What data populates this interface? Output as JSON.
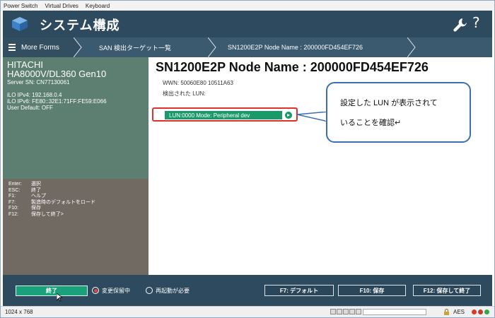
{
  "menubar": {
    "items": [
      "Power Switch",
      "Virtual Drives",
      "Keyboard"
    ]
  },
  "app": {
    "title": "システム構成"
  },
  "nav": {
    "more_forms": "More Forms",
    "crumbs": [
      "SAN 検出ターゲット一覧",
      "SN1200E2P Node Name : 200000FD454EF726"
    ]
  },
  "server": {
    "vendor": "HITACHI",
    "model": "HA8000V/DL360 Gen10",
    "serial": "Server SN: CN77130061",
    "ipv4": "iLO IPv4: 192.168.0.4",
    "ipv6": "iLO IPv6: FE80::32E1:71FF:FE59:E066",
    "user_default": "User Default: OFF"
  },
  "help_keys": [
    {
      "key": "Enter:",
      "desc": "選択"
    },
    {
      "key": "ESC:",
      "desc": "終了"
    },
    {
      "key": "F1:",
      "desc": "ヘルプ"
    },
    {
      "key": "F7:",
      "desc": "製造時のデフォルトをロード"
    },
    {
      "key": "F10:",
      "desc": "保存"
    },
    {
      "key": "F12:",
      "desc": "保存して終了>"
    }
  ],
  "main": {
    "title": "SN1200E2P Node Name : 200000FD454EF726",
    "wwn": "WWN: 50060E80 10511A63",
    "detected_lun": "検出された LUN:",
    "lun_entry": "LUN:0000 Mode: Peripheral dev"
  },
  "callout": {
    "line1": "設定した LUN が表示されて",
    "line2": "いることを確認↵"
  },
  "bottom": {
    "exit": "終了",
    "radio_changes_pending": "変更保留中",
    "radio_reboot_required": "再起動が必要",
    "f7": "F7: デフォルト",
    "f10": "F10: 保存",
    "f12": "F12: 保存して終了"
  },
  "status": {
    "resolution": "1024 x 768",
    "encryption": "AES"
  },
  "colors": {
    "titlebar": "#2e4a5e",
    "server_panel": "#5d7f72",
    "help_panel": "#716a63",
    "accent_green": "#1a9a6b",
    "highlight_red": "#e0302a",
    "callout_border": "#3a6fb3"
  },
  "icons": {
    "logo": "cube-logo-icon",
    "settings": "wrench-icon",
    "help": "question-mark-icon",
    "menu": "hamburger-icon",
    "lun_arrow": "arrow-right-circle-icon"
  }
}
